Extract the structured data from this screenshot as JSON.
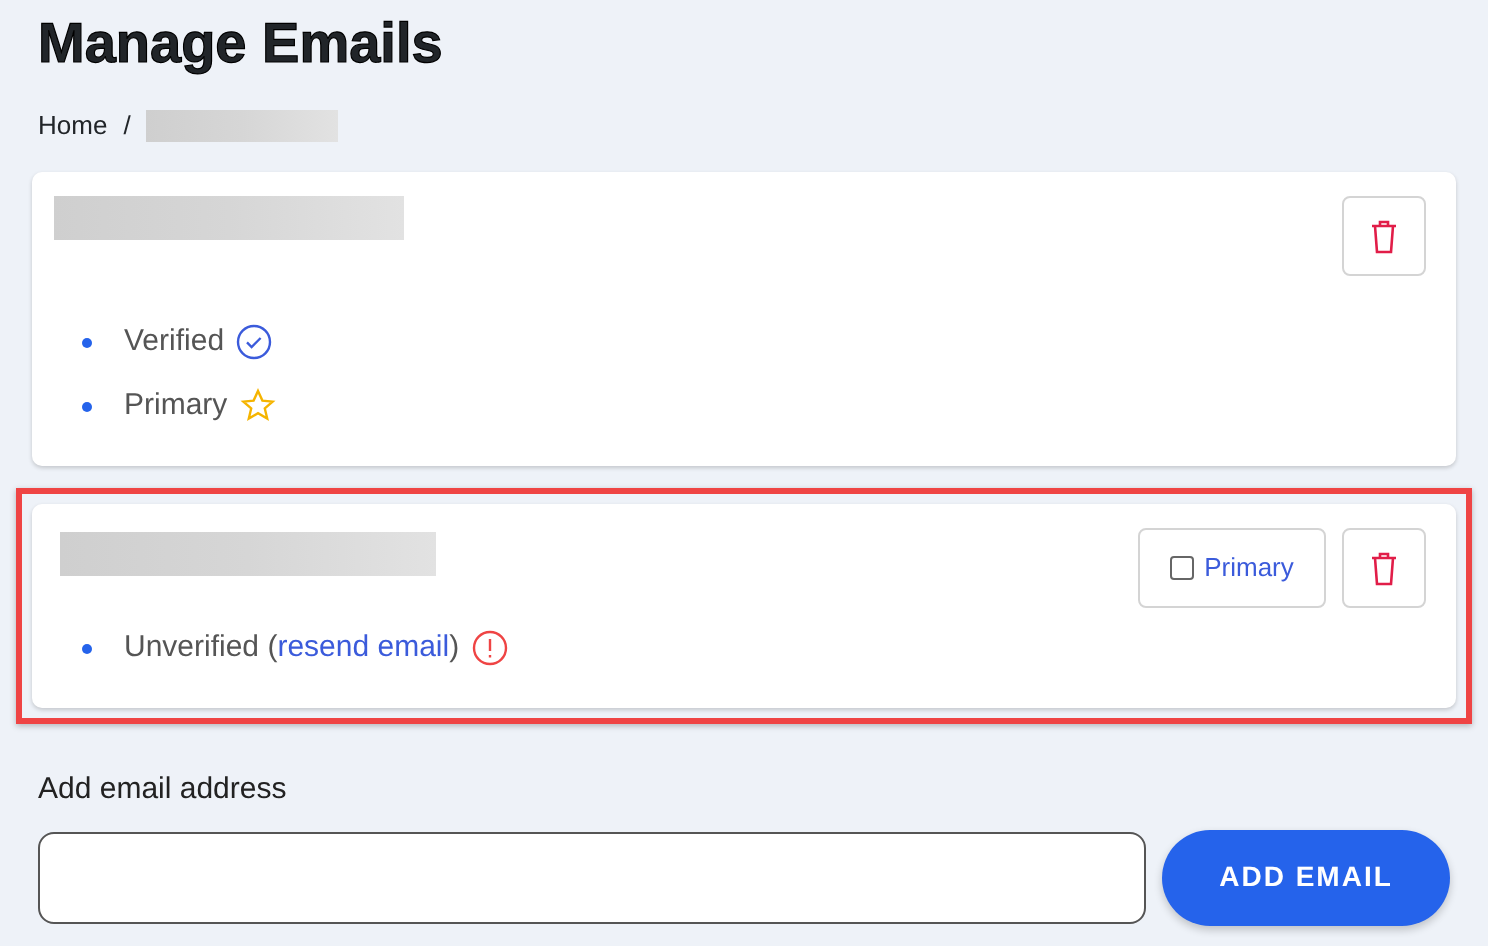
{
  "page_title": "Manage Emails",
  "breadcrumb": {
    "separator": "/",
    "items": [
      {
        "label": "Home"
      },
      {
        "redacted": true
      }
    ]
  },
  "emails": [
    {
      "redacted": true,
      "highlighted": false,
      "statuses": [
        {
          "kind": "verified",
          "text": "Verified"
        },
        {
          "kind": "primary",
          "text": "Primary"
        }
      ]
    },
    {
      "redacted": true,
      "highlighted": true,
      "primary_toggle": {
        "label": "Primary",
        "checked": false
      },
      "statuses": [
        {
          "kind": "unverified",
          "text": "Unverified (",
          "link": "resend email",
          "suffix": ")"
        }
      ]
    }
  ],
  "add_email": {
    "label": "Add email address",
    "button": "ADD EMAIL"
  }
}
